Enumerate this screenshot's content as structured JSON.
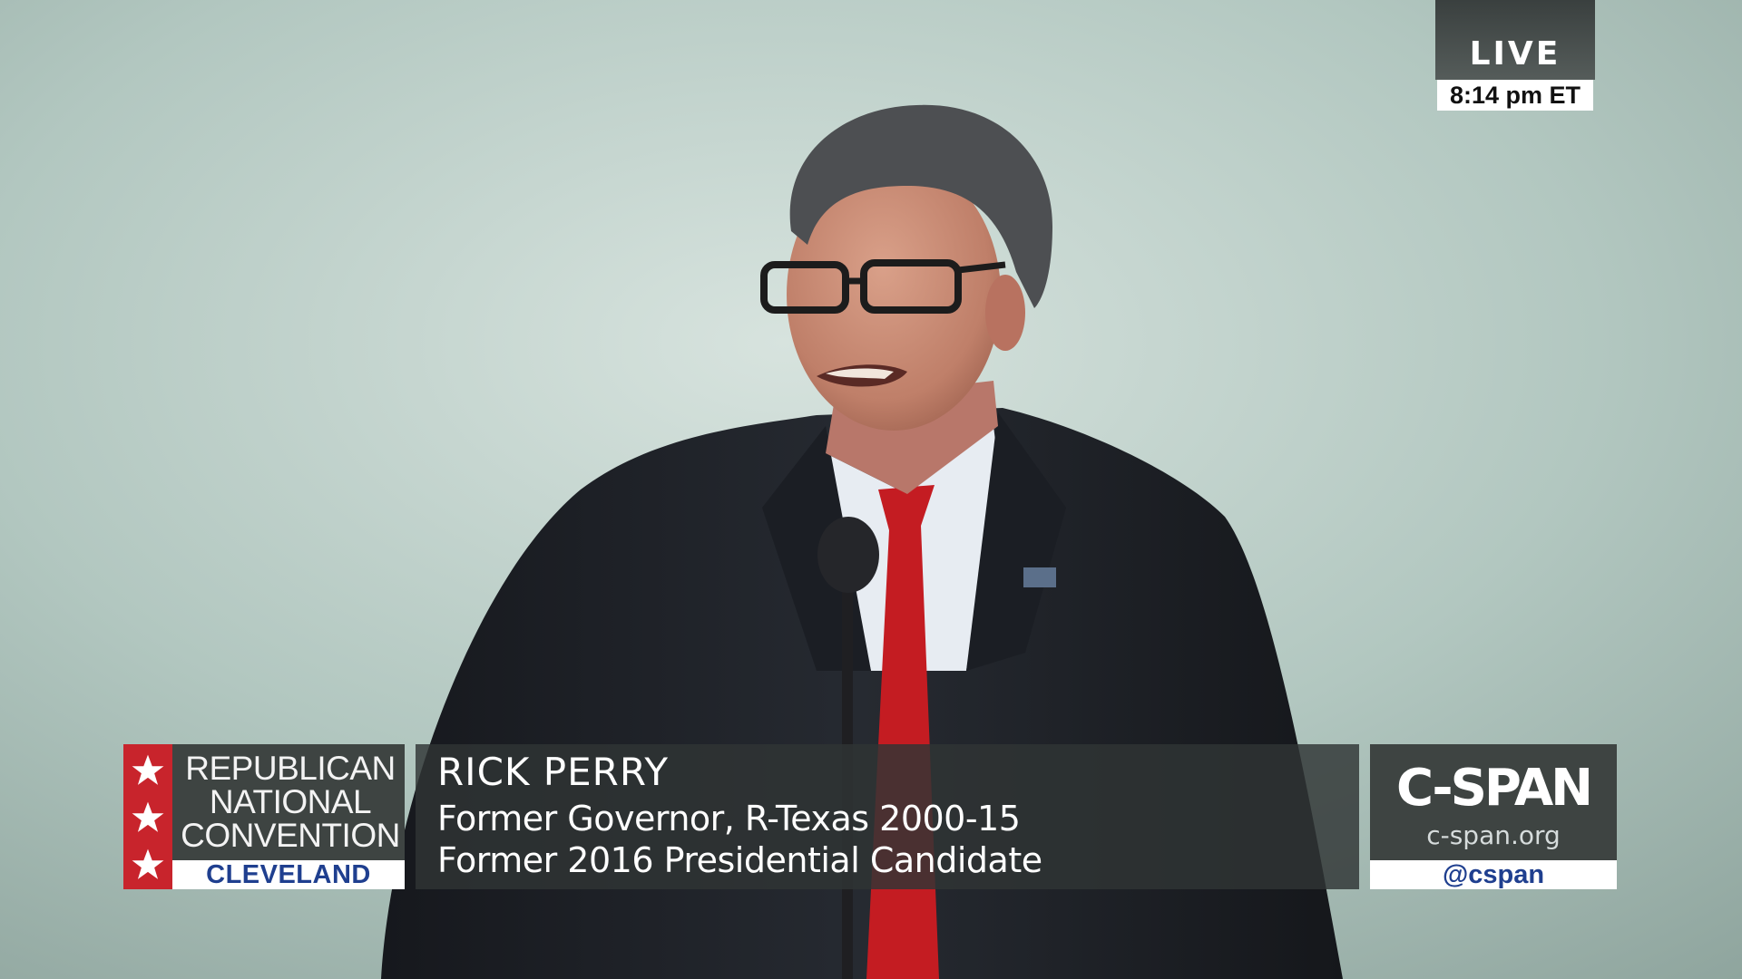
{
  "live_bug": {
    "label": "LIVE",
    "time": "8:14 pm ET"
  },
  "lower_third": {
    "event": {
      "lines": [
        "REPUBLICAN",
        "NATIONAL",
        "CONVENTION"
      ],
      "city": "CLEVELAND"
    },
    "speaker": {
      "name": "RICK PERRY",
      "title_1": "Former Governor, R-Texas 2000-15",
      "title_2": "Former 2016 Presidential Candidate"
    },
    "network": {
      "logo": "C-SPAN",
      "url": "c-span.org",
      "handle": "@cspan"
    }
  },
  "icons": {
    "event_badge": "star-icon"
  },
  "colors": {
    "background": "#a9bfb7",
    "rnc_red": "#c8242c",
    "brand_blue": "#1f3f8f",
    "panel_gray": "#3e4442",
    "tie": "#c41c22",
    "suit": "#1d2026"
  }
}
